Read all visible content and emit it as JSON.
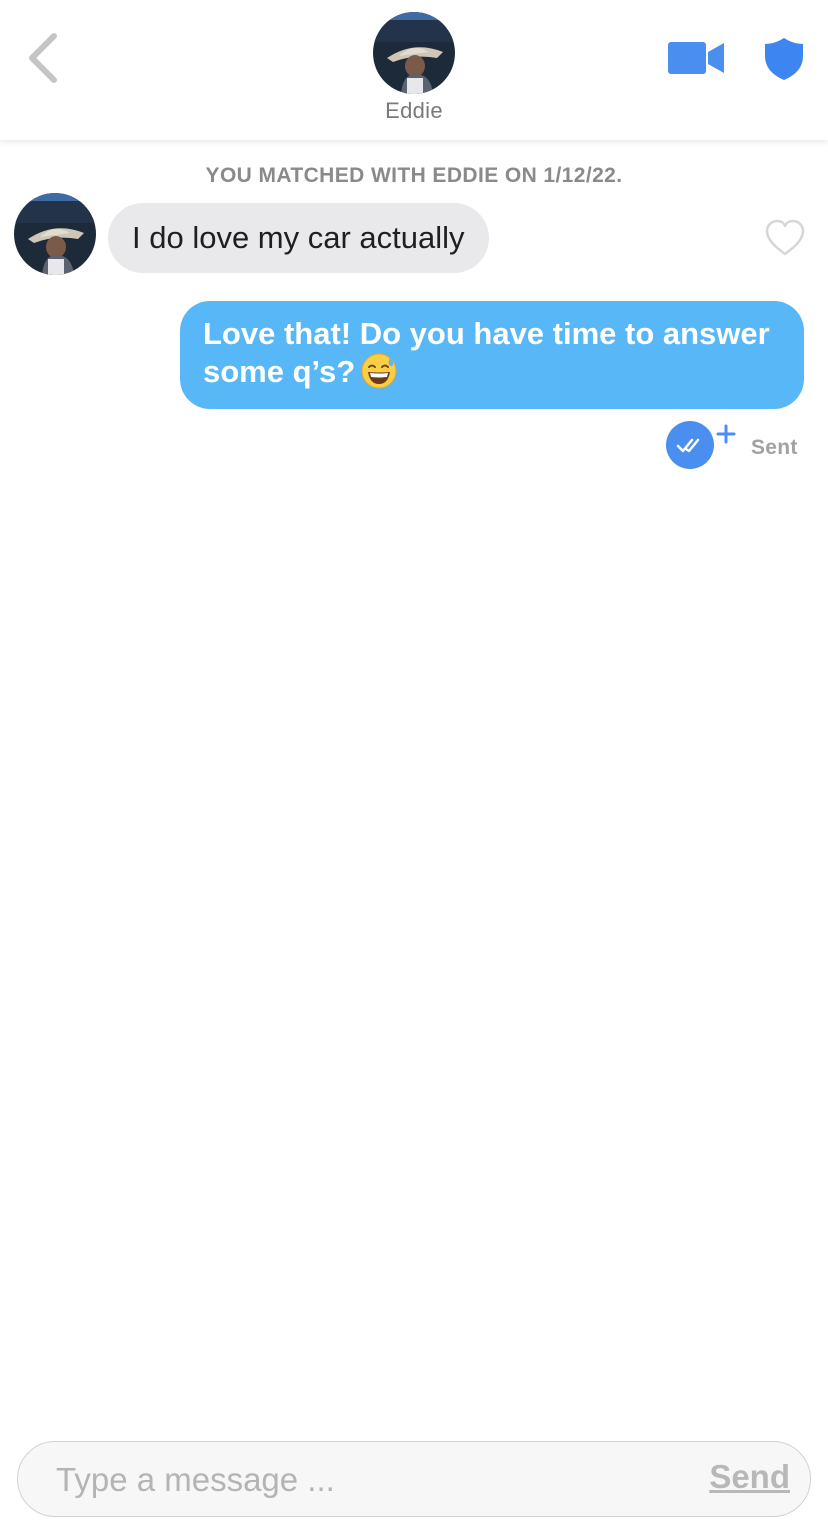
{
  "header": {
    "name": "Eddie",
    "back_icon": "chevron-left-icon",
    "video_icon": "video-camera-icon",
    "shield_icon": "shield-icon"
  },
  "conversation": {
    "match_banner": "YOU MATCHED WITH EDDIE ON 1/12/22.",
    "messages": [
      {
        "direction": "incoming",
        "text": "I do love my car actually"
      },
      {
        "direction": "outgoing",
        "text": "Love that! Do you have time to answer some q’s?",
        "emoji": "grinning-face-with-sweat-emoji",
        "status": "Sent"
      }
    ]
  },
  "composer": {
    "placeholder": "Type a message ...",
    "send_label": "Send"
  },
  "colors": {
    "accent_blue": "#4a8ef0",
    "outgoing_bubble": "#58b8f7",
    "incoming_bubble": "#e9e9eb",
    "muted_text": "#8a8a8a"
  }
}
